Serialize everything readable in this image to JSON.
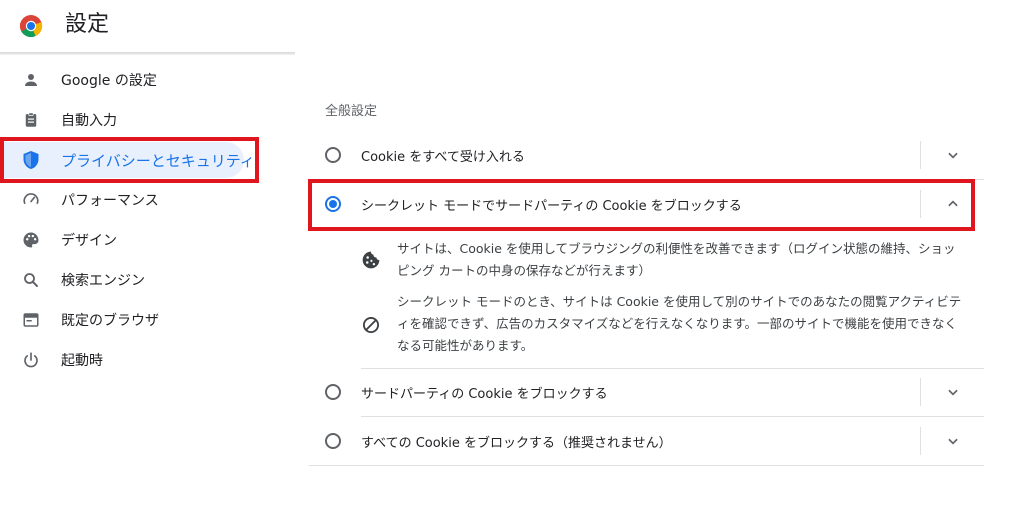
{
  "app": {
    "title": "設定"
  },
  "sidebar": {
    "items": [
      {
        "label": "Google の設定",
        "icon": "person-icon"
      },
      {
        "label": "自動入力",
        "icon": "clipboard-icon"
      },
      {
        "label": "プライバシーとセキュリティ",
        "icon": "shield-icon",
        "active": true
      },
      {
        "label": "パフォーマンス",
        "icon": "speedometer-icon"
      },
      {
        "label": "デザイン",
        "icon": "palette-icon"
      },
      {
        "label": "検索エンジン",
        "icon": "search-icon"
      },
      {
        "label": "既定のブラウザ",
        "icon": "browser-window-icon"
      },
      {
        "label": "起動時",
        "icon": "power-icon"
      }
    ]
  },
  "main": {
    "section_title": "全般設定",
    "options": [
      {
        "label": "Cookie をすべて受け入れる",
        "checked": false,
        "expanded": false
      },
      {
        "label": "シークレット モードでサードパーティの Cookie をブロックする",
        "checked": true,
        "expanded": true
      },
      {
        "label": "サードパーティの Cookie をブロックする",
        "checked": false,
        "expanded": false
      },
      {
        "label": "すべての Cookie をブロックする（推奨されません）",
        "checked": false,
        "expanded": false
      }
    ],
    "details": [
      {
        "icon": "cookie-icon",
        "text": "サイトは、Cookie を使用してブラウジングの利便性を改善できます（ログイン状態の維持、ショッピング カートの中身の保存などが行えます）"
      },
      {
        "icon": "block-icon",
        "text": "シークレット モードのとき、サイトは Cookie を使用して別のサイトでのあなたの閲覧アクティビティを確認できず、広告のカスタマイズなどを行えなくなります。一部のサイトで機能を使用できなくなる可能性があります。"
      }
    ]
  },
  "colors": {
    "accent": "#1a73e8",
    "active_bg": "#e8f0fe",
    "highlight": "#e0161e",
    "text": "#202124",
    "muted": "#5f6368"
  }
}
